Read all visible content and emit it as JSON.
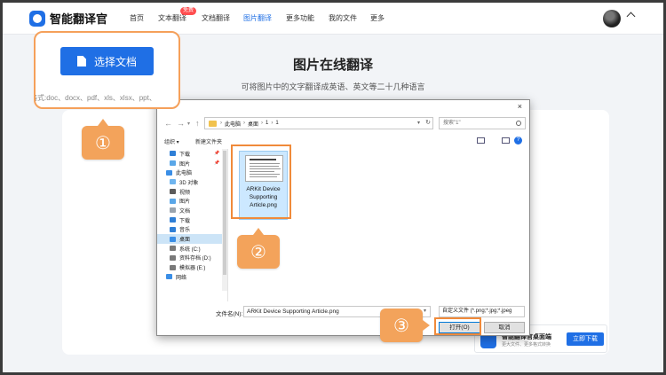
{
  "app": {
    "name": "智能翻译官"
  },
  "nav": {
    "items": [
      "首页",
      "文本翻译",
      "文档翻译",
      "图片翻译",
      "更多功能",
      "我的文件",
      "更多"
    ],
    "active_index": 3,
    "badge": "免费"
  },
  "page": {
    "title": "图片在线翻译",
    "subtitle": "可将图片中的文字翻译成英语、英文等二十几种语言"
  },
  "upload": {
    "button_label": "选择文档",
    "formats": "格式:doc、docx、pdf、xls、xlsx、ppt、"
  },
  "markers": [
    "①",
    "②",
    "③"
  ],
  "dialog": {
    "close": "×",
    "breadcrumb": [
      "此电脑",
      "桌面",
      "1",
      "1"
    ],
    "search_placeholder": "搜索\"1\"",
    "toolbar": {
      "organize": "组织 ▾",
      "new_folder": "新建文件夹"
    },
    "nav_items": [
      {
        "label": "下载",
        "icon": "download-icon",
        "pinned": true
      },
      {
        "label": "图片",
        "icon": "pictures-icon",
        "pinned": true
      },
      {
        "label": "此电脑",
        "icon": "pc-icon",
        "pinned": false
      },
      {
        "label": "3D 对象",
        "icon": "3d-objects-icon",
        "pinned": false
      },
      {
        "label": "视频",
        "icon": "video-icon",
        "pinned": false
      },
      {
        "label": "图片",
        "icon": "pictures-icon",
        "pinned": false
      },
      {
        "label": "文档",
        "icon": "documents-icon",
        "pinned": false
      },
      {
        "label": "下载",
        "icon": "download-icon",
        "pinned": false
      },
      {
        "label": "音乐",
        "icon": "music-icon",
        "pinned": false
      },
      {
        "label": "桌面",
        "icon": "desktop-icon",
        "pinned": false,
        "selected": true
      },
      {
        "label": "系统 (C:)",
        "icon": "drive-icon",
        "pinned": false
      },
      {
        "label": "资料存档 (D:)",
        "icon": "drive-icon",
        "pinned": false
      },
      {
        "label": "模拟器 (E:)",
        "icon": "drive-icon",
        "pinned": false
      },
      {
        "label": "网络",
        "icon": "network-icon",
        "pinned": false
      }
    ],
    "file": {
      "name": "ARKit Device Supporting Article.png"
    },
    "filename_label": "文件名(N):",
    "filename_value": "ARKit Device Supporting Article.png",
    "filter": "自定义文件 (*.png;*.jpg;*.jpeg",
    "open_button": "打开(O)",
    "cancel_button": "取消"
  },
  "banner": {
    "title": "智能翻译官桌面端",
    "subtitle": "更大文件、更多格式转换",
    "button": "立即下载"
  },
  "colors": {
    "accent": "#1f6fe5",
    "marker": "#f3a35b",
    "highlight": "#f08a3a"
  }
}
